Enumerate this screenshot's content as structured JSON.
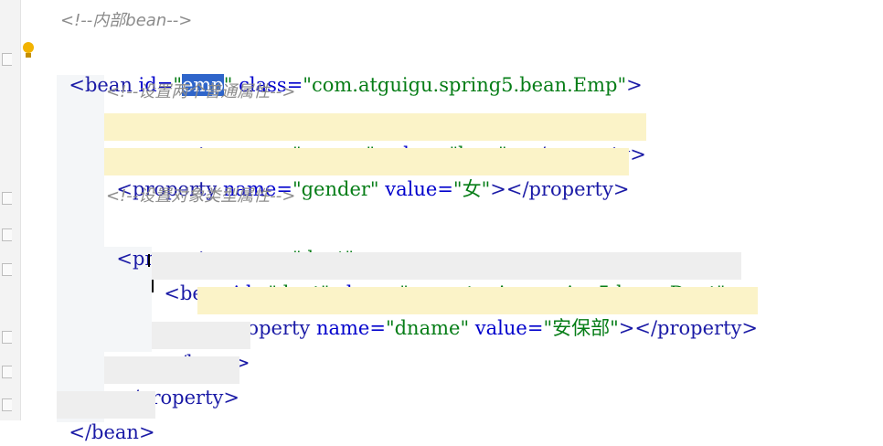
{
  "editor": {
    "comment_inner_bean": "<!--内部bean-->",
    "bean_emp": {
      "open": "<bean ",
      "id_attr": "id=",
      "id_q1": "\"",
      "id_value": "emp",
      "id_q2": "\"",
      "class_attr": "class=",
      "class_value": "\"com.atguigu.spring5.bean.Emp\"",
      "close": ">"
    },
    "comment_normal": "<!--设置两个普通属性-->",
    "prop_ename": {
      "open": "<property ",
      "name_attr": "name=",
      "name_value": "\"ename\"",
      "value_attr": "value=",
      "value_value": "\"lucy\"",
      "end": "></property>"
    },
    "prop_gender": {
      "open": "<property ",
      "name_attr": "name=",
      "name_value": "\"gender\"",
      "value_attr": "value=",
      "value_value": "\"女\"",
      "end": "></property>"
    },
    "comment_object": "<!--设置对象类型属性-->",
    "prop_dept_open": {
      "open": "<property ",
      "name_attr": "name=",
      "name_value": "\"dept\"",
      "close": ">"
    },
    "bean_dept": {
      "open": "<bean ",
      "id_attr": "id=",
      "id_value": "\"dept\"",
      "class_attr": "class=",
      "class_value": "\"com.atguigu.spring5.bean.Dept\"",
      "close": ">"
    },
    "prop_dname": {
      "open": "<property ",
      "name_attr": "name=",
      "name_value": "\"dname\"",
      "value_attr": "value=",
      "value_value": "\"安保部\"",
      "end": "></property>"
    },
    "bean_close": "</bean>",
    "property_close": "</property>",
    "bean_close_outer": "</bean>"
  }
}
